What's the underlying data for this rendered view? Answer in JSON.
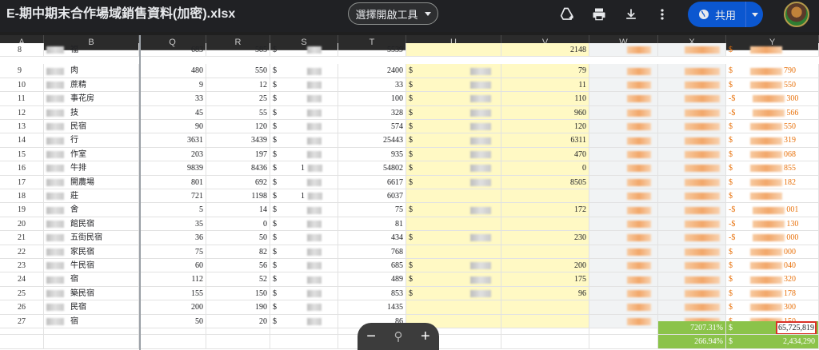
{
  "header": {
    "doc_title": "E-期中期末合作場域銷售資料(加密).xlsx",
    "open_with_label": "選擇開啟工具",
    "share_label": "共用"
  },
  "icons": [
    "add-to-drive-icon",
    "print-icon",
    "download-icon",
    "more-vert-icon",
    "globe-icon",
    "dropdown-caret-icon",
    "zoom-out-icon",
    "zoom-reset-icon",
    "zoom-in-icon"
  ],
  "colors": {
    "yellow_fill": "#fff9c4",
    "green_fill": "#8bc34a",
    "highlight": "#d93025",
    "share_blue": "#0b57d0"
  },
  "sheet": {
    "columns": [
      "A",
      "B",
      "Q",
      "R",
      "S",
      "T",
      "U",
      "V",
      "W",
      "X",
      "Y"
    ],
    "rows": [
      {
        "n": "8",
        "b": "福",
        "q": "683",
        "r": "585",
        "s": "$",
        "t": "5539",
        "u": "",
        "v": "2148",
        "dollar_u": false
      },
      {
        "n": "9",
        "b": "肉",
        "q": "480",
        "r": "550",
        "s": "$",
        "t": "2400",
        "u": "$",
        "v": "79",
        "y": "790"
      },
      {
        "n": "10",
        "b": "蔗精",
        "q": "9",
        "r": "12",
        "s": "$",
        "t": "33",
        "u": "$",
        "v": "11",
        "y": "550"
      },
      {
        "n": "11",
        "b": "事花房",
        "q": "33",
        "r": "25",
        "s": "$",
        "t": "100",
        "u": "$",
        "v": "110",
        "y": "300",
        "neg": true
      },
      {
        "n": "12",
        "b": "技",
        "q": "45",
        "r": "55",
        "s": "$",
        "t": "328",
        "u": "$",
        "v": "960",
        "y": "566",
        "neg": true
      },
      {
        "n": "13",
        "b": "民宿",
        "q": "90",
        "r": "120",
        "s": "$",
        "t": "574",
        "u": "$",
        "v": "120",
        "y": "550"
      },
      {
        "n": "14",
        "b": "行",
        "q": "3631",
        "r": "3439",
        "s": "$",
        "t": "25443",
        "u": "$",
        "v": "6311",
        "y": "319"
      },
      {
        "n": "15",
        "b": "作室",
        "q": "203",
        "r": "197",
        "s": "$",
        "t": "935",
        "u": "$",
        "v": "470",
        "y": "068"
      },
      {
        "n": "16",
        "b": "牛排",
        "q": "9839",
        "r": "8436",
        "s": "$",
        "t": "54802",
        "u": "$",
        "v": "0",
        "y": "855",
        "s_extra": "1"
      },
      {
        "n": "17",
        "b": "開農場",
        "q": "801",
        "r": "692",
        "s": "$",
        "t": "6617",
        "u": "$",
        "v": "8505",
        "y": "182"
      },
      {
        "n": "18",
        "b": "莊",
        "q": "721",
        "r": "1198",
        "s": "$",
        "t": "6037",
        "u": "",
        "v": "",
        "y": "",
        "s_extra": "1"
      },
      {
        "n": "19",
        "b": "舍",
        "q": "5",
        "r": "14",
        "s": "$",
        "t": "75",
        "u": "$",
        "v": "172",
        "y": "001",
        "neg": true
      },
      {
        "n": "20",
        "b": "館民宿",
        "q": "35",
        "r": "0",
        "s": "$",
        "t": "81",
        "u": "",
        "v": "",
        "y": "130",
        "neg": true
      },
      {
        "n": "21",
        "b": "五街民宿",
        "q": "36",
        "r": "50",
        "s": "$",
        "t": "434",
        "u": "$",
        "v": "230",
        "y": "000",
        "neg": true
      },
      {
        "n": "22",
        "b": "家民宿",
        "q": "75",
        "r": "82",
        "s": "$",
        "t": "768",
        "u": "",
        "v": "",
        "y": "000"
      },
      {
        "n": "23",
        "b": "牛民宿",
        "q": "60",
        "r": "56",
        "s": "$",
        "t": "685",
        "u": "$",
        "v": "200",
        "y": "040"
      },
      {
        "n": "24",
        "b": "宿",
        "q": "112",
        "r": "52",
        "s": "$",
        "t": "489",
        "u": "$",
        "v": "175",
        "y": "320"
      },
      {
        "n": "25",
        "b": "築民宿",
        "q": "155",
        "r": "150",
        "s": "$",
        "t": "853",
        "u": "$",
        "v": "96",
        "y": "178"
      },
      {
        "n": "26",
        "b": "民宿",
        "q": "200",
        "r": "190",
        "s": "$",
        "t": "1435",
        "u": "",
        "v": "",
        "y": "300"
      },
      {
        "n": "27",
        "b": "宿",
        "q": "50",
        "r": "20",
        "s": "$",
        "t": "86",
        "u": "",
        "v": "",
        "y": "150"
      }
    ],
    "summary": [
      {
        "x": "7207.31%",
        "y_sym": "$",
        "y": "65,725,819"
      },
      {
        "x": "266.94%",
        "y_sym": "$",
        "y": "2,434,290"
      }
    ]
  }
}
